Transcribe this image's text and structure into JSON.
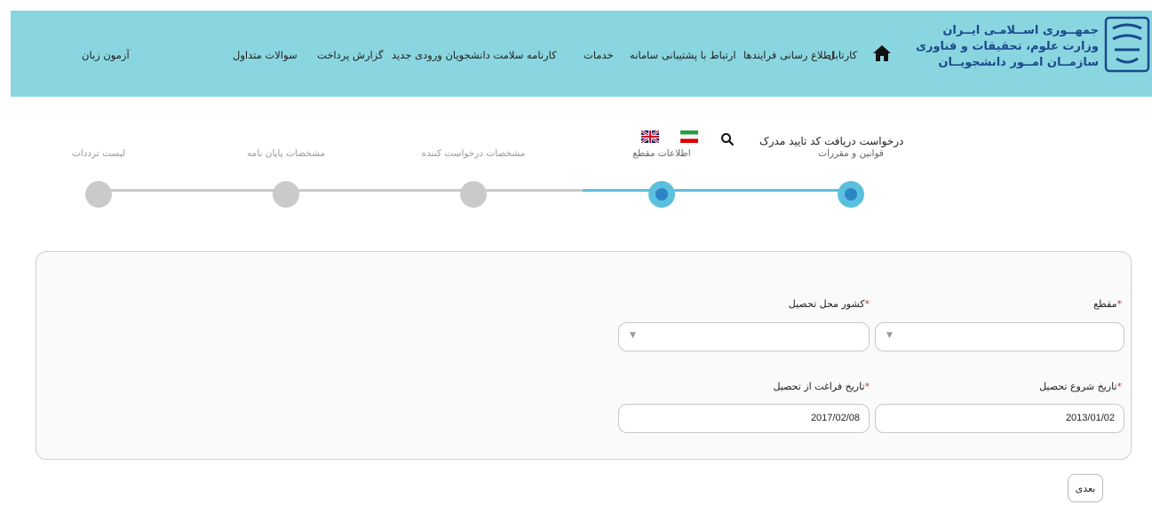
{
  "header": {
    "logo_lines": [
      "جمهــوری اســلامـی ایــران",
      "وزارت علوم، تحقیقات و فناوری",
      "سازمــان امــور دانشجویــان"
    ],
    "nav": [
      "کارتابل",
      "اطلاع رسانی فرایندها",
      "ارتباط با پشتیبانی سامانه",
      "خدمات",
      "کارنامه سلامت دانشجویان ورودی جدید",
      "گزارش پرداخت",
      "سوالات متداول",
      "آزمون زبان"
    ]
  },
  "page": {
    "title": "درخواست دریافت کد تایید مدرک"
  },
  "wizard": {
    "steps": [
      {
        "label": "قوانین و مقررات",
        "state": "done"
      },
      {
        "label": "اطلاعات مقطع",
        "state": "current"
      },
      {
        "label": "مشخصات درخواست کننده",
        "state": "pending"
      },
      {
        "label": "مشخصات پایان نامه",
        "state": "pending"
      },
      {
        "label": "لیست ترددات",
        "state": "pending"
      }
    ]
  },
  "form": {
    "degree_label": "مقطع",
    "country_label": "کشور محل تحصیل",
    "degree_value": "",
    "country_value": "",
    "start_date_label": "تاریخ شروع تحصیل",
    "start_date_value": "2013/01/02",
    "end_date_label": "تاریخ فراغت از تحصیل",
    "end_date_value": "2017/02/08",
    "required_mark": "*"
  },
  "actions": {
    "next_label": "بعدی"
  },
  "colors": {
    "header_bg": "#8ad6e0",
    "step_active": "#5bc0de",
    "step_inner": "#2d86c4",
    "step_inactive": "#cacaca"
  },
  "icons": [
    "home-icon",
    "search-icon",
    "uk-flag-icon",
    "iran-flag-icon",
    "chevron-down-icon"
  ]
}
